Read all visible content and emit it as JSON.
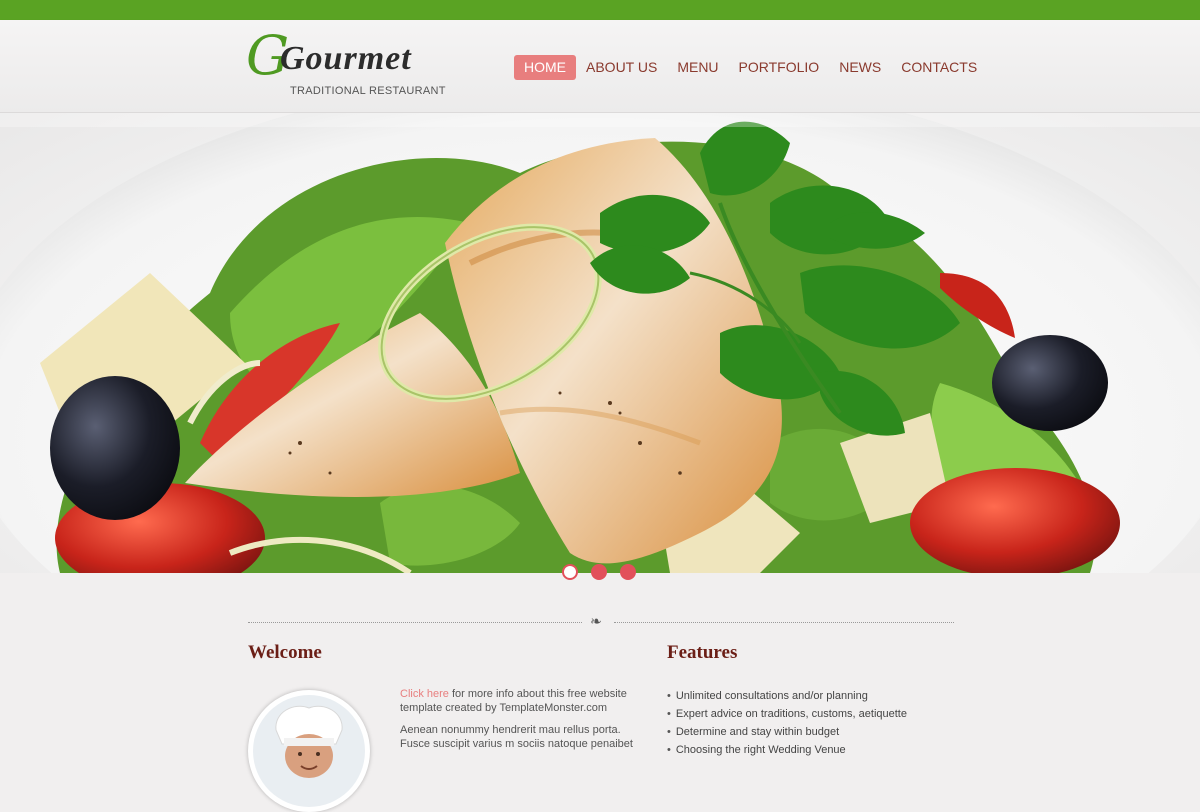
{
  "brand": {
    "logo_text": "Gourmet",
    "tagline": "TRADITIONAL RESTAURANT",
    "accent": "#5aa323",
    "nav_active_bg": "#e87e7e",
    "nav_text": "#8a3a2e"
  },
  "nav": {
    "items": [
      {
        "label": "HOME",
        "active": true
      },
      {
        "label": "ABOUT US"
      },
      {
        "label": "MENU"
      },
      {
        "label": "PORTFOLIO"
      },
      {
        "label": "NEWS"
      },
      {
        "label": "CONTACTS"
      }
    ]
  },
  "slider": {
    "image_icon": "food-photo",
    "dots_count": 3,
    "active_dot": 0
  },
  "welcome": {
    "title": "Welcome",
    "link_text": "Click here",
    "text1": " for more info about this free website template created by TemplateMonster.com",
    "text2": "Aenean nonummy hendrerit mau rellus porta. Fusce suscipit varius m sociis natoque penaibet"
  },
  "features": {
    "title": "Features",
    "items": [
      "Unlimited consultations and/or planning",
      "Expert advice on traditions, customs, aetiquette",
      "Determine and stay within budget",
      "Choosing the right Wedding Venue"
    ]
  }
}
